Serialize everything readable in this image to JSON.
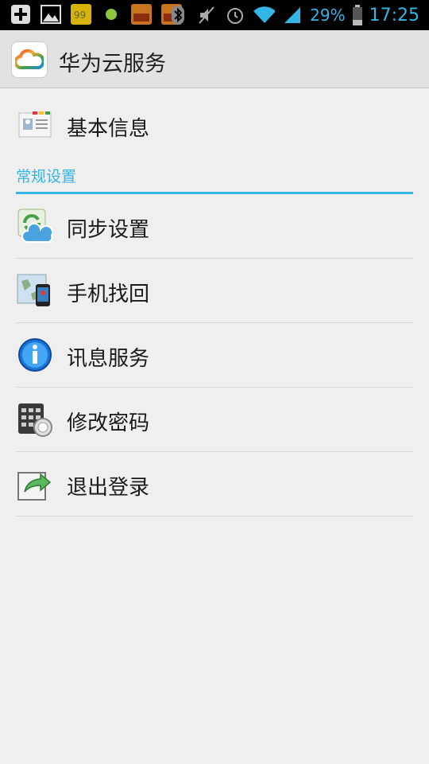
{
  "status_bar": {
    "battery": "29%",
    "time": "17:25",
    "icons": [
      "add-icon",
      "image-icon",
      "app-icon",
      "dot-icon",
      "app-icon",
      "app-icon",
      "bluetooth-icon",
      "mute-icon",
      "alarm-icon",
      "wifi-icon",
      "signal-icon",
      "battery-icon"
    ]
  },
  "app_bar": {
    "title": "华为云服务"
  },
  "items": {
    "basic_info": "基本信息",
    "section_general": "常规设置",
    "sync": "同步设置",
    "find_phone": "手机找回",
    "messaging": "讯息服务",
    "change_password": "修改密码",
    "logout": "退出登录"
  },
  "colors": {
    "accent": "#33b5e5",
    "background": "#efefef",
    "action_bar": "#e2e2e2"
  }
}
